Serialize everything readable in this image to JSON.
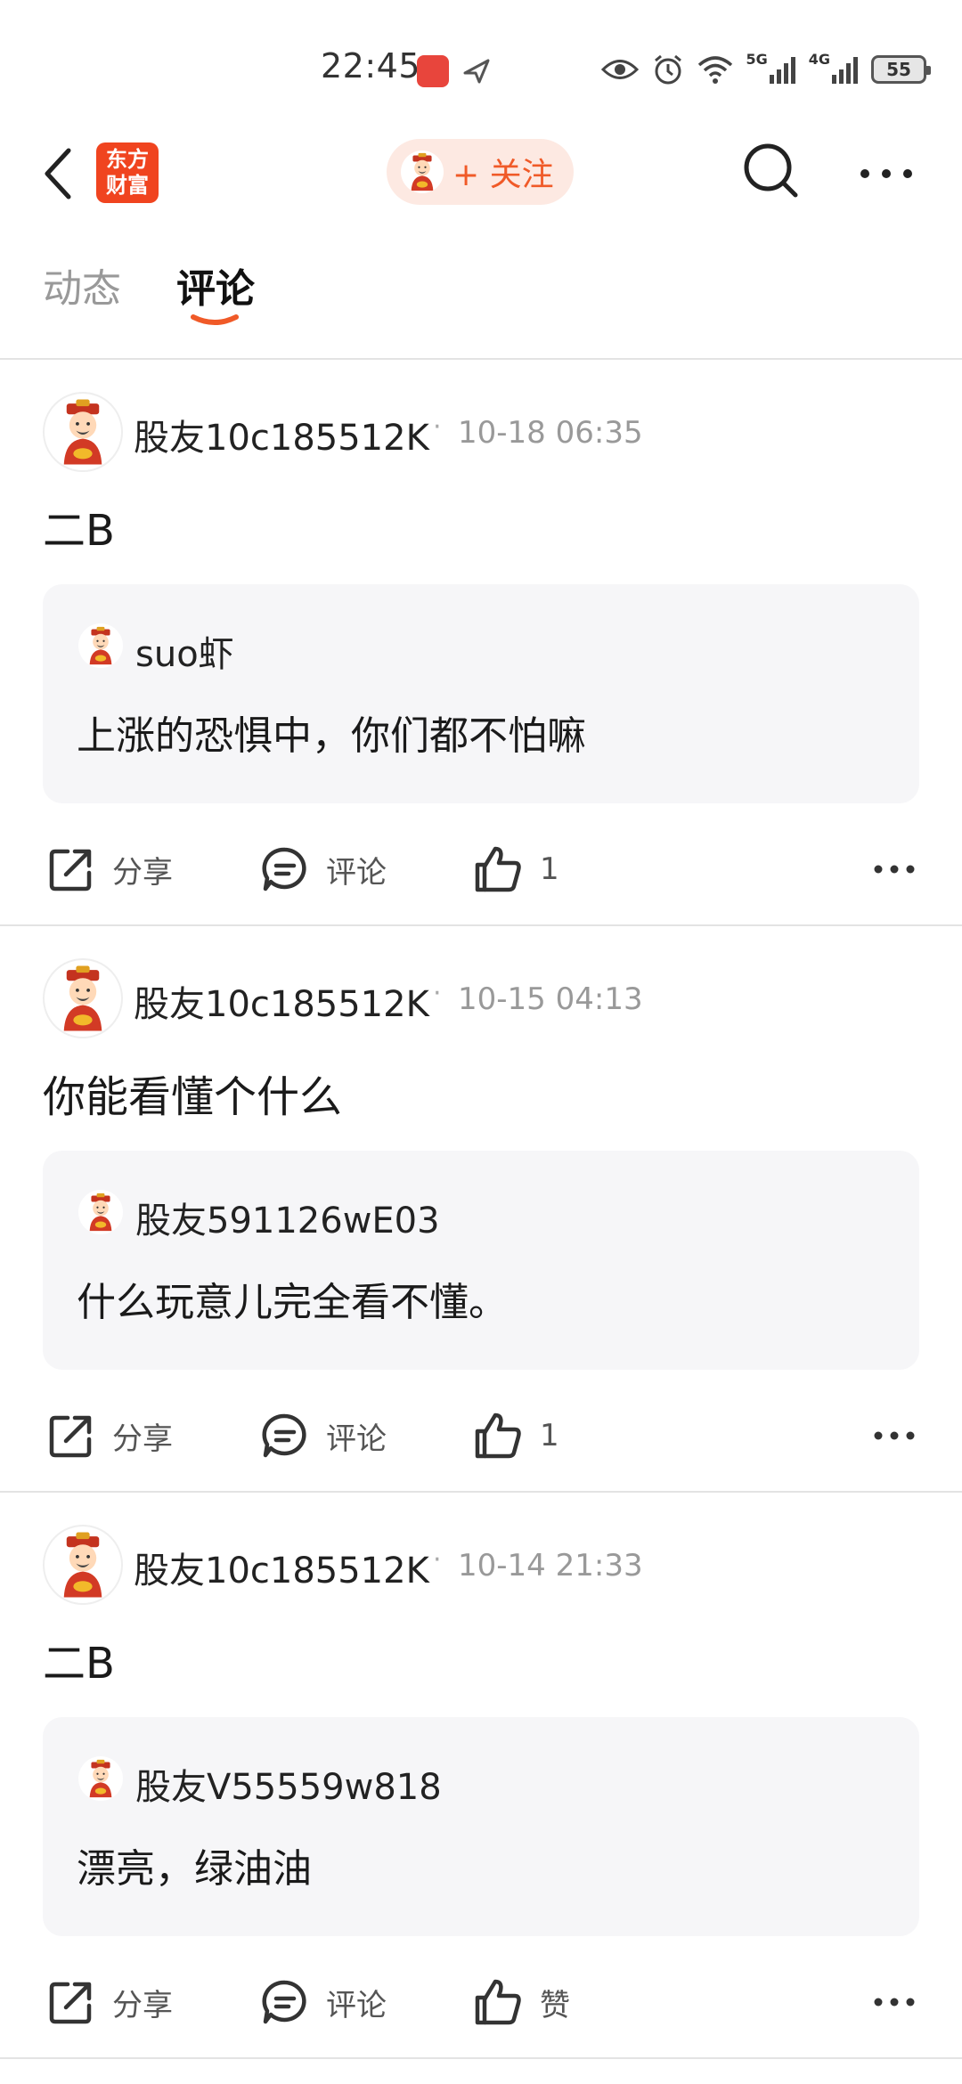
{
  "status_bar": {
    "time": "22:45",
    "network_1": "5G",
    "network_2": "4G",
    "battery": "55"
  },
  "header": {
    "logo_line1": "东方",
    "logo_line2": "财富",
    "follow_label": "+ 关注"
  },
  "tabs": [
    {
      "label": "动态",
      "active": false
    },
    {
      "label": "评论",
      "active": true
    }
  ],
  "colors": {
    "accent": "#f05a28",
    "logo_bg": "#f0441f",
    "quote_bg": "#f6f6f8"
  },
  "posts": [
    {
      "author": "股友10c185512K",
      "time": "10-18 06:35",
      "text": "二B",
      "quote": {
        "author": "suo虾",
        "text": "上涨的恐惧中，你们都不怕嘛"
      },
      "share_label": "分享",
      "comment_label": "评论",
      "like_label": "1"
    },
    {
      "author": "股友10c185512K",
      "time": "10-15 04:13",
      "text": "你能看懂个什么",
      "quote": {
        "author": "股友591126wE03",
        "text": "什么玩意儿完全看不懂。"
      },
      "share_label": "分享",
      "comment_label": "评论",
      "like_label": "1"
    },
    {
      "author": "股友10c185512K",
      "time": "10-14 21:33",
      "text": "二B",
      "quote": {
        "author": "股友V55559w818",
        "text": "漂亮，绿油油"
      },
      "share_label": "分享",
      "comment_label": "评论",
      "like_label": "赞"
    }
  ]
}
